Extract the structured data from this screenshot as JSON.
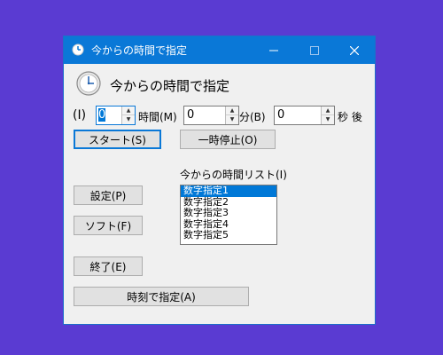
{
  "window": {
    "title": "今からの時間で指定"
  },
  "header": {
    "title": "今からの時間で指定"
  },
  "time_row": {
    "prefix_label": "(I)",
    "hours_value": "0",
    "hours_label": "時間(M)",
    "minutes_value": "0",
    "minutes_label": "分(B)",
    "seconds_value": "0",
    "seconds_label": "秒 後"
  },
  "buttons": {
    "start": "スタート(S)",
    "pause": "一時停止(O)",
    "settings": "設定(P)",
    "soft": "ソフト(F)",
    "exit": "終了(E)",
    "specify_time": "時刻で指定(A)"
  },
  "list": {
    "label": "今からの時間リスト(I)",
    "items": [
      "数字指定1",
      "数字指定2",
      "数字指定3",
      "数字指定4",
      "数字指定5"
    ],
    "selected_index": 0
  },
  "colors": {
    "desktop": "#5a3bd2",
    "titlebar": "#0a78d7",
    "selection": "#0078d7"
  }
}
